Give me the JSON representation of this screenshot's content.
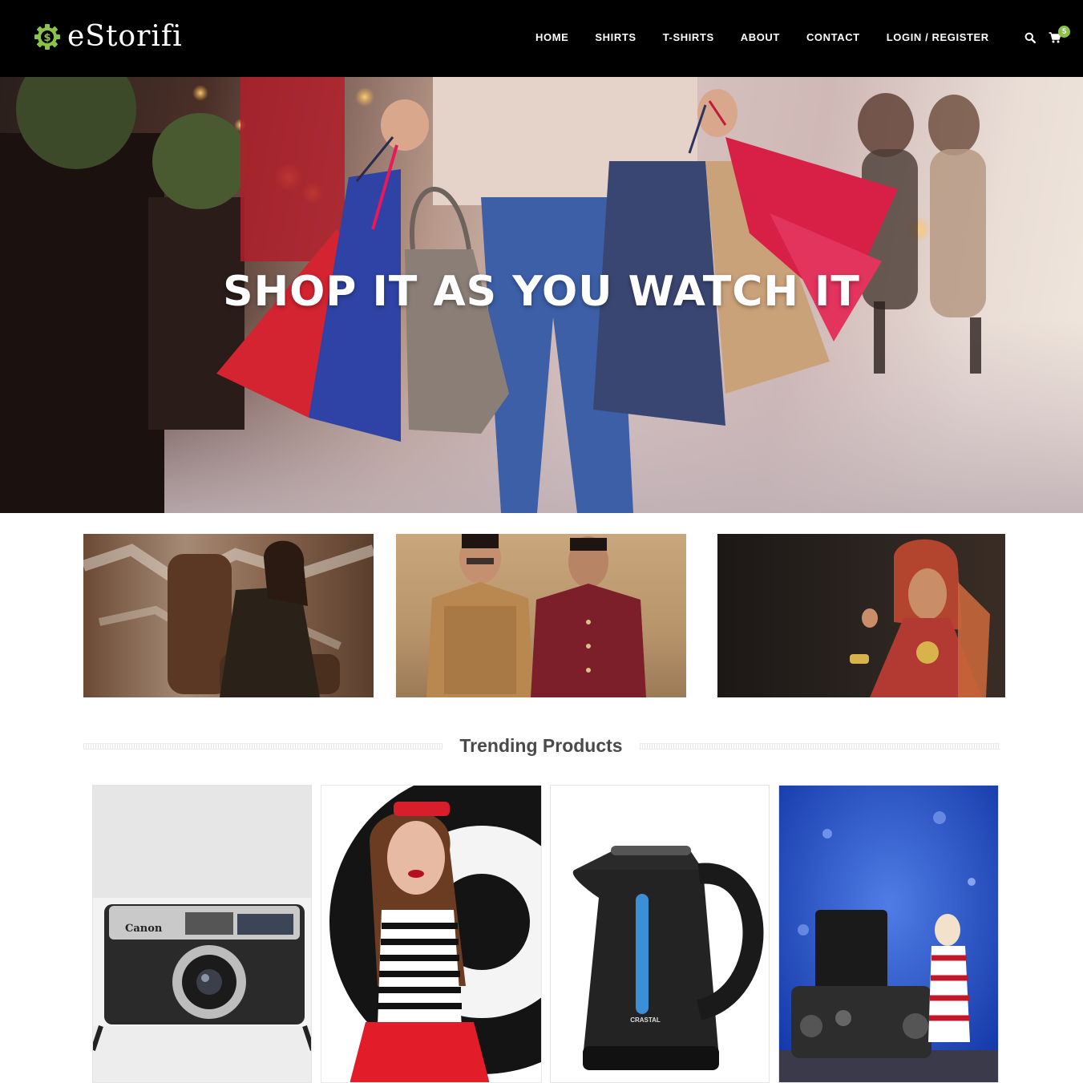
{
  "brand": {
    "name": "eStorifi",
    "icon": "dollar-gear-icon",
    "accent": "#8bc34a"
  },
  "nav": {
    "items": [
      "HOME",
      "SHIRTS",
      "T-SHIRTS",
      "ABOUT",
      "CONTACT",
      "LOGIN / REGISTER"
    ],
    "search_icon": "search-icon",
    "cart_icon": "cart-icon",
    "cart_count": "5"
  },
  "hero": {
    "headline": "SHOP IT AS YOU WATCH IT"
  },
  "categories": [
    {
      "image": "woman-in-patterned-dress-on-carved-chair"
    },
    {
      "image": "two-men-in-sherwani-jackets"
    },
    {
      "image": "woman-in-traditional-bridal-attire"
    }
  ],
  "trending": {
    "title": "Trending Products",
    "products": [
      {
        "image": "canon-rangefinder-camera"
      },
      {
        "image": "woman-in-red-sunglasses-striped-top"
      },
      {
        "image": "black-electric-kettle"
      },
      {
        "image": "camera-with-knitted-toy"
      }
    ]
  },
  "colors": {
    "header_bg": "#000000",
    "nav_text": "#ffffff",
    "heading_text": "#4a4a4a"
  }
}
